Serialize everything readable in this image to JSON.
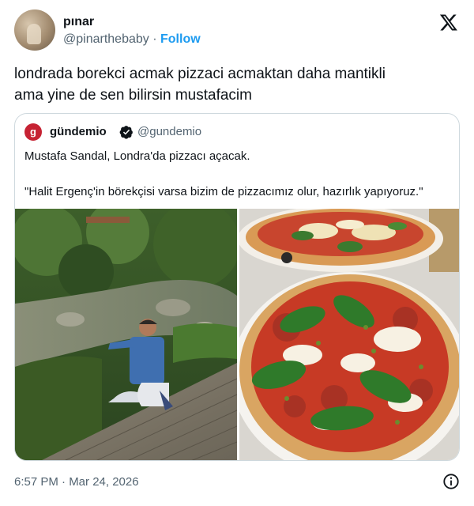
{
  "author": {
    "display_name": "pınar",
    "handle": "@pinarthebaby",
    "separator": "·",
    "follow_label": "Follow"
  },
  "tweet": {
    "text_line1": "londrada borekci acmak pizzaci acmaktan daha mantikli",
    "text_line2": "ama yine de sen bilirsin mustafacim"
  },
  "quote": {
    "avatar_letter": "g",
    "display_name": "gündemio",
    "handle": "@gundemio",
    "line1": "Mustafa Sandal, Londra'da pizzacı açacak.",
    "line2": "\"Halit Ergenç'in börekçisi varsa bizim de pizzacımız olur, hazırlık yapıyoruz.\""
  },
  "footer": {
    "timestamp": "6:57 PM · Mar 24, 2026"
  },
  "icons": {
    "platform": "x-logo-icon",
    "verified": "verified-badge-icon",
    "info": "info-icon"
  },
  "colors": {
    "accent": "#1d9bf0",
    "text": "#0f1419",
    "muted": "#536471",
    "border": "#cfd9de",
    "quote_avatar": "#c62233"
  }
}
